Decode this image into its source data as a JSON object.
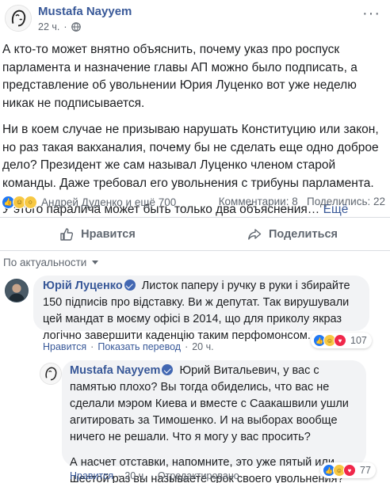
{
  "post": {
    "author": "Mustafa Nayyem",
    "time": "22 ч.",
    "paragraphs": [
      "А кто-то может внятно объяснить, почему указ про роспуск парламента и назначение главы АП можно было подписать, а представление об увольнении Юрия Луценко вот уже неделю никак не подписывается.",
      "Ни в коем случае не призываю нарушать Конституцию или закон, но раз такая вакханалия, почему бы не сделать еще одно доброе дело? Президент же сам называл Луценко членом старой команды. Даже требовал его увольнения с трибуны парламента."
    ],
    "last_line": "У этого паралича может быть только два объяснения…",
    "see_more": "Ещё"
  },
  "reactions": {
    "names": "Андрей Дуденко и ещё 700",
    "comments": "Комментарии: 8",
    "shares": "Поделились: 22"
  },
  "actions": {
    "like": "Нравится",
    "share": "Поделиться"
  },
  "sort_label": "По актуальности",
  "comments": [
    {
      "author": "Юрій Луценко",
      "text": "Листок паперу і ручку в руки і збирайте 150 підписів про відставку. Ви ж депутат. Так вирушували цей мандат в моєму офісі в 2014, що для приколу якраз логічно завершити каденцію таким перфомонсом.",
      "like": "Нравится",
      "translate": "Показать перевод",
      "time": "20 ч.",
      "reaction_count": "107"
    },
    {
      "author": "Mustafa Nayyem",
      "text1": "Юрий Витальевич, у вас с памятью плохо? Вы тогда обиделись, что вас не сделали мэром Киева и вместе с Саакашвили ушли агитировать за Тимошенко. И на выборах вообще ничего не решали. Что я могу у вас просить?",
      "text2": "А насчет отставки, напомните, это уже пятый или шестой раз вы называете срок своего увольнения?",
      "like": "Нравится",
      "time": "20 ч.",
      "edited": "Отредактировано",
      "reaction_count": "77"
    }
  ],
  "colors": {
    "link": "#385898",
    "secondary": "#606770",
    "bubble": "#f2f3f5",
    "like": "#2078f4",
    "love": "#f0284a",
    "haha": "#f7c843"
  }
}
